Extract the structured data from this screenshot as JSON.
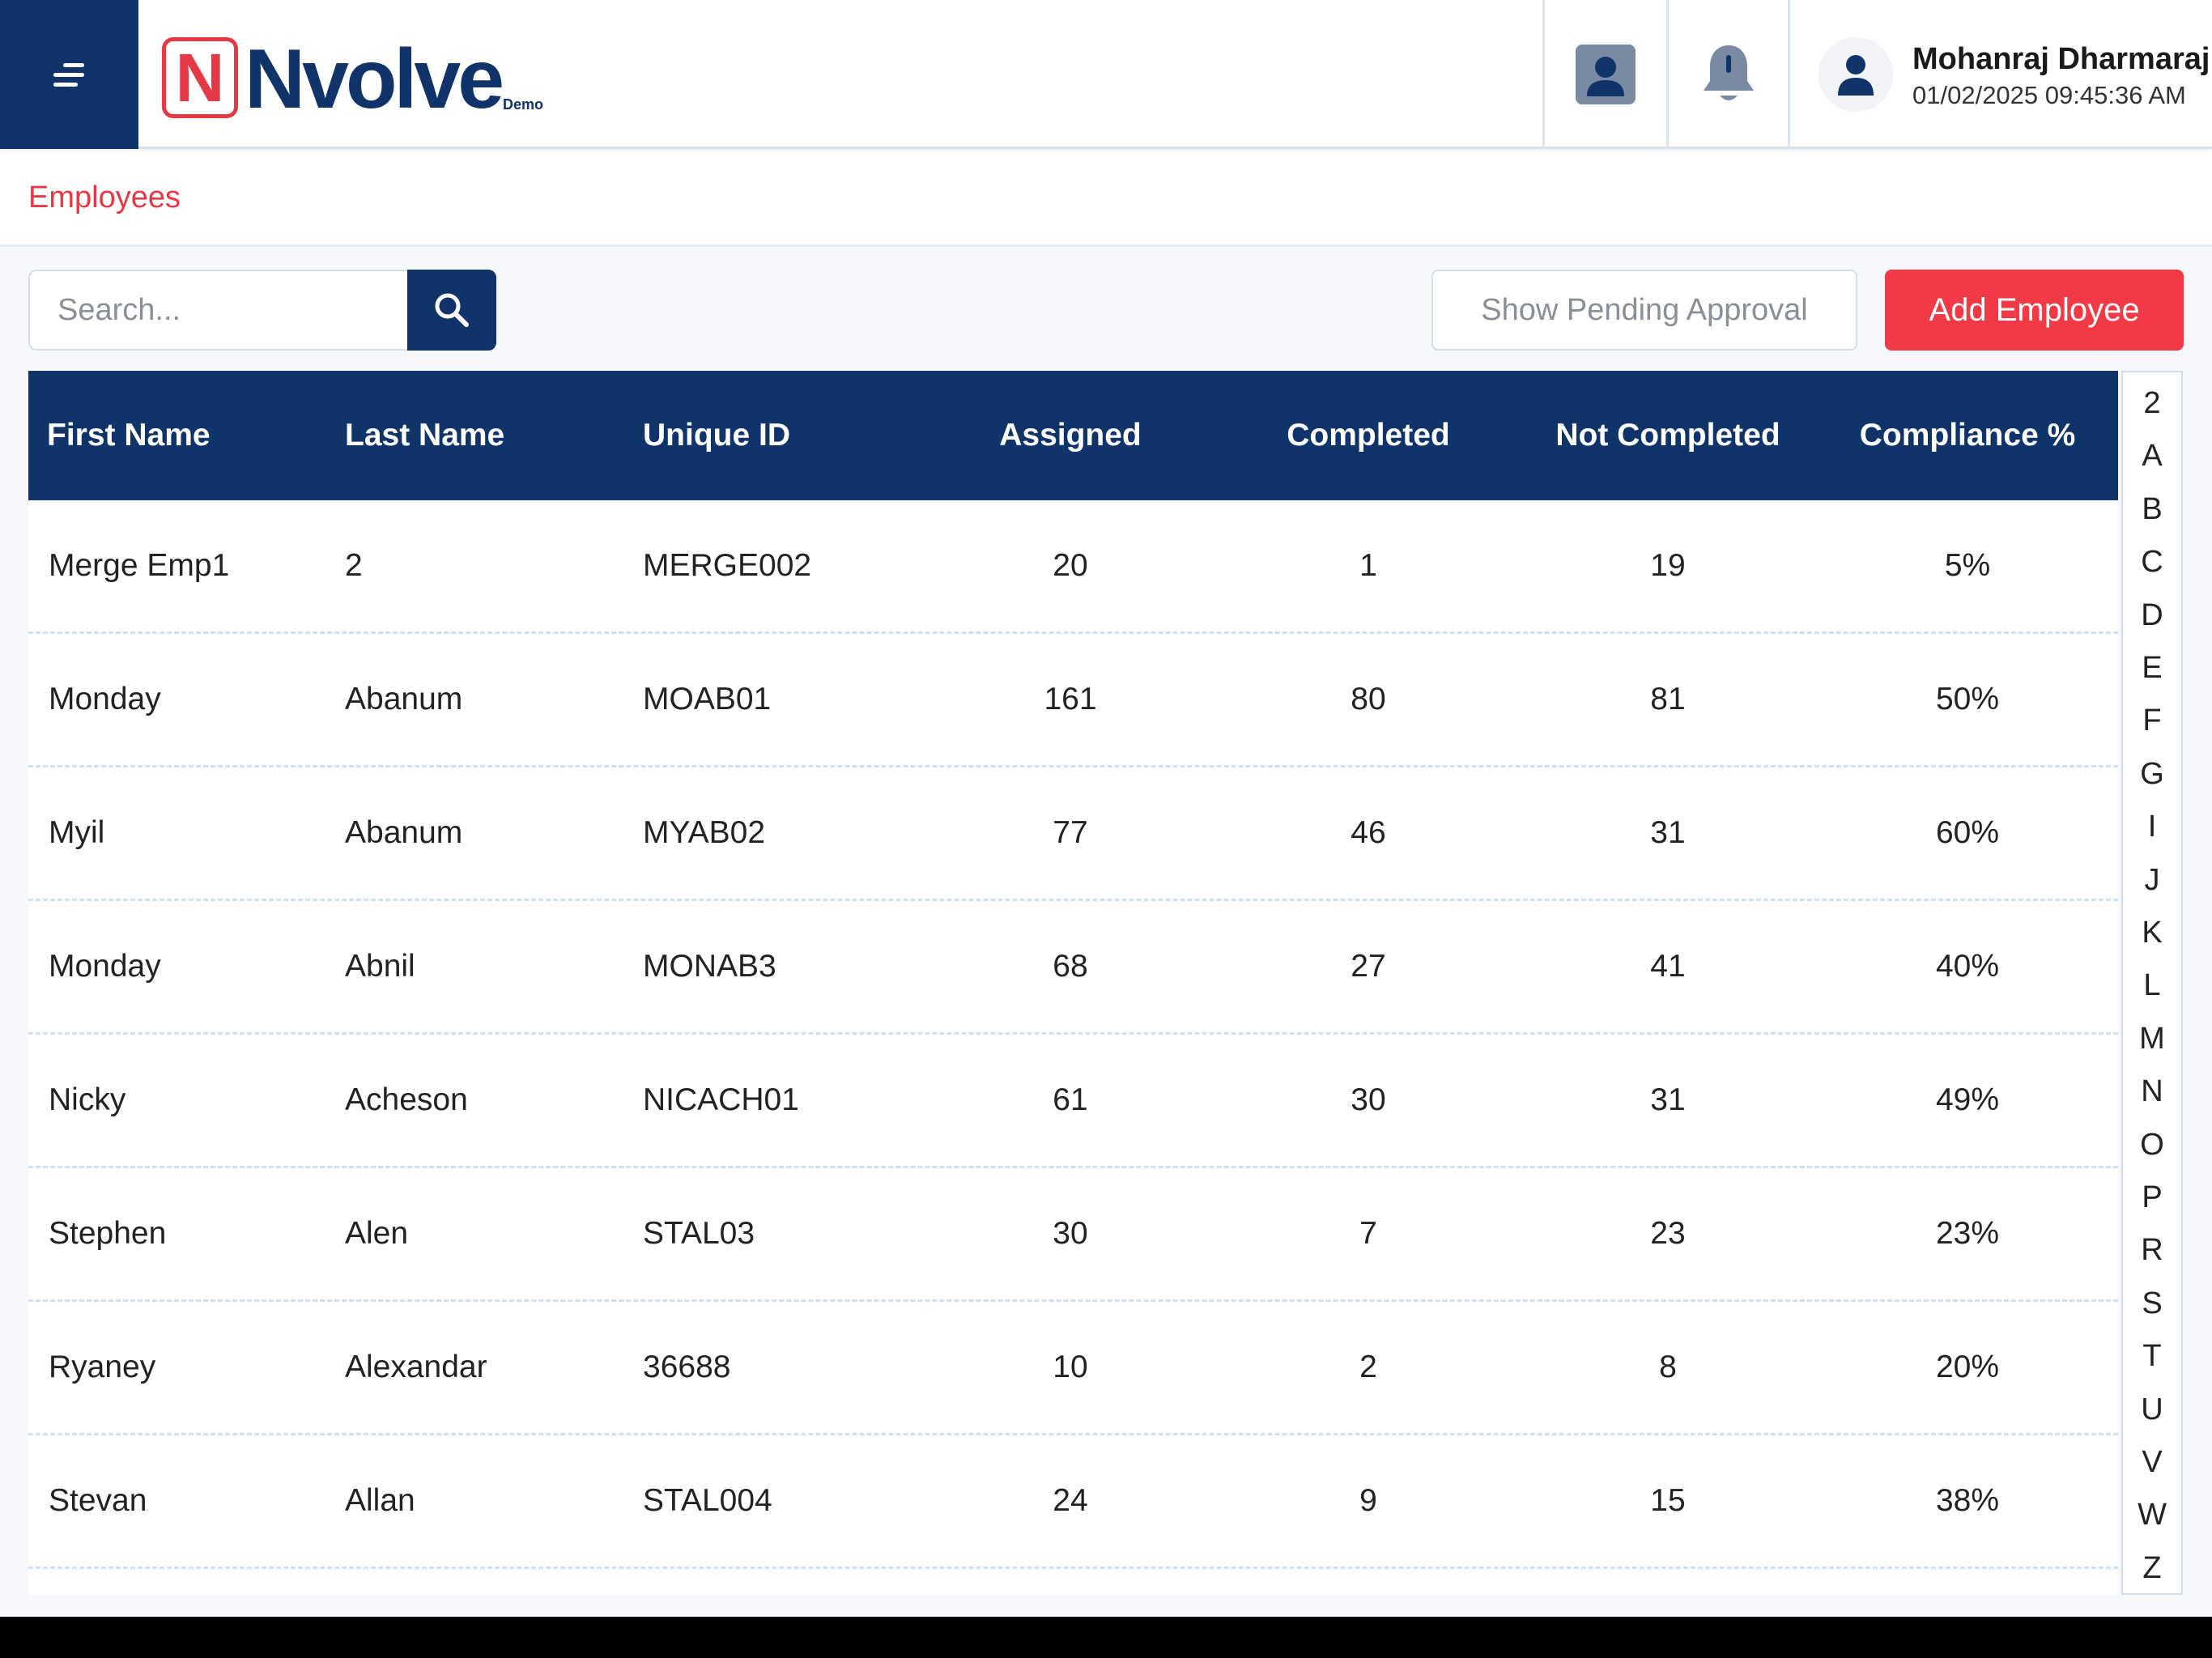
{
  "header": {
    "brand_letter": "N",
    "brand_name": "Nvolve",
    "brand_tag": "Demo",
    "user_name": "Mohanraj Dharmaraj",
    "user_datetime": "01/02/2025 09:45:36 AM"
  },
  "breadcrumb": {
    "current": "Employees"
  },
  "toolbar": {
    "search_placeholder": "Search...",
    "pending_label": "Show Pending Approval",
    "add_label": "Add Employee"
  },
  "table": {
    "columns": [
      "First Name",
      "Last Name",
      "Unique ID",
      "Assigned",
      "Completed",
      "Not Completed",
      "Compliance %"
    ],
    "rows": [
      [
        "Merge Emp1",
        "2",
        "MERGE002",
        "20",
        "1",
        "19",
        "5%"
      ],
      [
        "Monday",
        "Abanum",
        "MOAB01",
        "161",
        "80",
        "81",
        "50%"
      ],
      [
        "Myil",
        "Abanum",
        "MYAB02",
        "77",
        "46",
        "31",
        "60%"
      ],
      [
        "Monday",
        "Abnil",
        "MONAB3",
        "68",
        "27",
        "41",
        "40%"
      ],
      [
        "Nicky",
        "Acheson",
        "NICACH01",
        "61",
        "30",
        "31",
        "49%"
      ],
      [
        "Stephen",
        "Alen",
        "STAL03",
        "30",
        "7",
        "23",
        "23%"
      ],
      [
        "Ryaney",
        "Alexandar",
        "36688",
        "10",
        "2",
        "8",
        "20%"
      ],
      [
        "Stevan",
        "Allan",
        "STAL004",
        "24",
        "9",
        "15",
        "38%"
      ]
    ]
  },
  "alpha_index": [
    "2",
    "A",
    "B",
    "C",
    "D",
    "E",
    "F",
    "G",
    "I",
    "J",
    "K",
    "L",
    "M",
    "N",
    "O",
    "P",
    "R",
    "S",
    "T",
    "U",
    "V",
    "W",
    "Z"
  ],
  "colors": {
    "primary": "#10336a",
    "accent": "#f23a46"
  }
}
